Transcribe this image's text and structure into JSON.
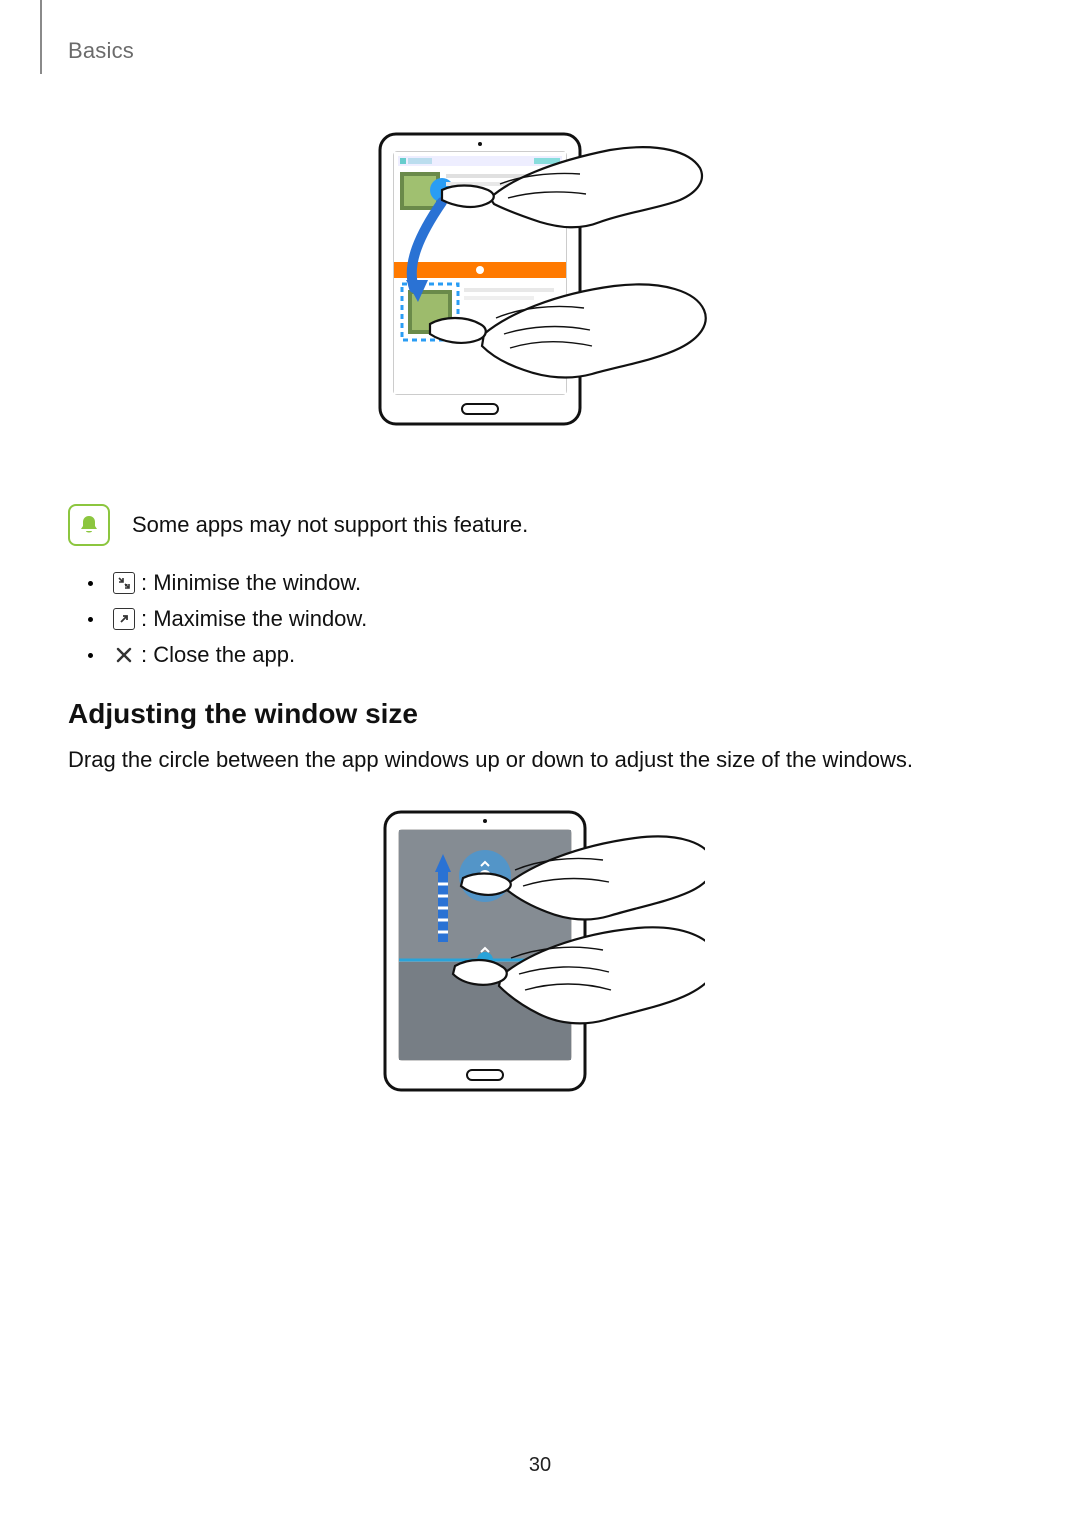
{
  "header": {
    "section": "Basics"
  },
  "note": {
    "text": "Some apps may not support this feature."
  },
  "bullets": [
    {
      "icon": "minimise",
      "text": " : Minimise the window."
    },
    {
      "icon": "maximise",
      "text": " : Maximise the window."
    },
    {
      "icon": "close",
      "text": " : Close the app."
    }
  ],
  "section2": {
    "heading": "Adjusting the window size",
    "body": "Drag the circle between the app windows up or down to adjust the size of the windows."
  },
  "page_number": "30"
}
